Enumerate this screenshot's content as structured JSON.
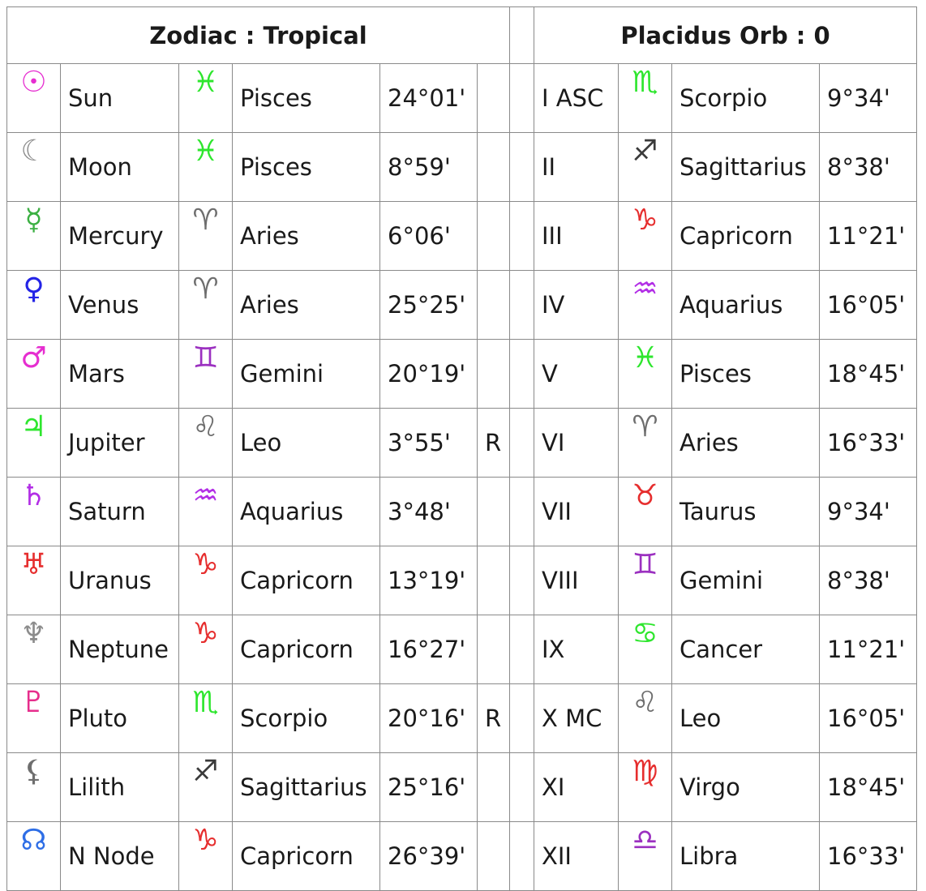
{
  "left_header": "Zodiac : Tropical",
  "right_header": "Placidus Orb : 0",
  "planets": [
    {
      "glyph": "☉",
      "glyph_name": "sun-icon",
      "glyph_color": "#e62ed0",
      "name": "Sun",
      "sign_glyph": "♓",
      "sign_icon": "pisces-icon",
      "sign_color": "#2ee62e",
      "sign": "Pisces",
      "degree": "24°01'",
      "retro": ""
    },
    {
      "glyph": "☾",
      "glyph_name": "moon-icon",
      "glyph_color": "#8c8c8c",
      "name": "Moon",
      "sign_glyph": "♓",
      "sign_icon": "pisces-icon",
      "sign_color": "#2ee62e",
      "sign": "Pisces",
      "degree": "8°59'",
      "retro": ""
    },
    {
      "glyph": "☿",
      "glyph_name": "mercury-icon",
      "glyph_color": "#3cb043",
      "name": "Mercury",
      "sign_glyph": "♈",
      "sign_icon": "aries-icon",
      "sign_color": "#6e6e6e",
      "sign": "Aries",
      "degree": "6°06'",
      "retro": ""
    },
    {
      "glyph": "♀",
      "glyph_name": "venus-icon",
      "glyph_color": "#2424e6",
      "name": "Venus",
      "sign_glyph": "♈",
      "sign_icon": "aries-icon",
      "sign_color": "#6e6e6e",
      "sign": "Aries",
      "degree": "25°25'",
      "retro": ""
    },
    {
      "glyph": "♂",
      "glyph_name": "mars-icon",
      "glyph_color": "#e62ed0",
      "name": "Mars",
      "sign_glyph": "♊",
      "sign_icon": "gemini-icon",
      "sign_color": "#9b30c0",
      "sign": "Gemini",
      "degree": "20°19'",
      "retro": ""
    },
    {
      "glyph": "♃",
      "glyph_name": "jupiter-icon",
      "glyph_color": "#2ee62e",
      "name": "Jupiter",
      "sign_glyph": "♌",
      "sign_icon": "leo-icon",
      "sign_color": "#6e6e6e",
      "sign": "Leo",
      "degree": "3°55'",
      "retro": "R"
    },
    {
      "glyph": "♄",
      "glyph_name": "saturn-icon",
      "glyph_color": "#b22ee6",
      "name": "Saturn",
      "sign_glyph": "♒",
      "sign_icon": "aquarius-icon",
      "sign_color": "#b22ee6",
      "sign": "Aquarius",
      "degree": "3°48'",
      "retro": ""
    },
    {
      "glyph": "♅",
      "glyph_name": "uranus-icon",
      "glyph_color": "#e62e2e",
      "name": "Uranus",
      "sign_glyph": "♑",
      "sign_icon": "capricorn-icon",
      "sign_color": "#e62e2e",
      "sign": "Capricorn",
      "degree": "13°19'",
      "retro": ""
    },
    {
      "glyph": "♆",
      "glyph_name": "neptune-icon",
      "glyph_color": "#8c8c8c",
      "name": "Neptune",
      "sign_glyph": "♑",
      "sign_icon": "capricorn-icon",
      "sign_color": "#e62e2e",
      "sign": "Capricorn",
      "degree": "16°27'",
      "retro": ""
    },
    {
      "glyph": "♇",
      "glyph_name": "pluto-icon",
      "glyph_color": "#e62e8c",
      "name": "Pluto",
      "sign_glyph": "♏",
      "sign_icon": "scorpio-icon",
      "sign_color": "#2ee62e",
      "sign": "Scorpio",
      "degree": "20°16'",
      "retro": "R"
    },
    {
      "glyph": "⚸",
      "glyph_name": "lilith-icon",
      "glyph_color": "#6e6e6e",
      "name": "Lilith",
      "sign_glyph": "♐",
      "sign_icon": "sagittarius-icon",
      "sign_color": "#3a3a3a",
      "sign": "Sagittarius",
      "degree": "25°16'",
      "retro": ""
    },
    {
      "glyph": "☊",
      "glyph_name": "north-node-icon",
      "glyph_color": "#2e6ee6",
      "name": "N Node",
      "sign_glyph": "♑",
      "sign_icon": "capricorn-icon",
      "sign_color": "#e62e2e",
      "sign": "Capricorn",
      "degree": "26°39'",
      "retro": ""
    }
  ],
  "houses": [
    {
      "house": "I ASC",
      "sign_glyph": "♏",
      "sign_icon": "scorpio-icon",
      "sign_color": "#2ee62e",
      "sign": "Scorpio",
      "degree": "9°34'"
    },
    {
      "house": "II",
      "sign_glyph": "♐",
      "sign_icon": "sagittarius-icon",
      "sign_color": "#3a3a3a",
      "sign": "Sagittarius",
      "degree": "8°38'"
    },
    {
      "house": "III",
      "sign_glyph": "♑",
      "sign_icon": "capricorn-icon",
      "sign_color": "#e62e2e",
      "sign": "Capricorn",
      "degree": "11°21'"
    },
    {
      "house": "IV",
      "sign_glyph": "♒",
      "sign_icon": "aquarius-icon",
      "sign_color": "#b22ee6",
      "sign": "Aquarius",
      "degree": "16°05'"
    },
    {
      "house": "V",
      "sign_glyph": "♓",
      "sign_icon": "pisces-icon",
      "sign_color": "#2ee62e",
      "sign": "Pisces",
      "degree": "18°45'"
    },
    {
      "house": "VI",
      "sign_glyph": "♈",
      "sign_icon": "aries-icon",
      "sign_color": "#6e6e6e",
      "sign": "Aries",
      "degree": "16°33'"
    },
    {
      "house": "VII",
      "sign_glyph": "♉",
      "sign_icon": "taurus-icon",
      "sign_color": "#e62e2e",
      "sign": "Taurus",
      "degree": "9°34'"
    },
    {
      "house": "VIII",
      "sign_glyph": "♊",
      "sign_icon": "gemini-icon",
      "sign_color": "#9b30c0",
      "sign": "Gemini",
      "degree": "8°38'"
    },
    {
      "house": "IX",
      "sign_glyph": "♋",
      "sign_icon": "cancer-icon",
      "sign_color": "#2ee62e",
      "sign": "Cancer",
      "degree": "11°21'"
    },
    {
      "house": "X MC",
      "sign_glyph": "♌",
      "sign_icon": "leo-icon",
      "sign_color": "#6e6e6e",
      "sign": "Leo",
      "degree": "16°05'"
    },
    {
      "house": "XI",
      "sign_glyph": "♍",
      "sign_icon": "virgo-icon",
      "sign_color": "#e62e2e",
      "sign": "Virgo",
      "degree": "18°45'"
    },
    {
      "house": "XII",
      "sign_glyph": "♎",
      "sign_icon": "libra-icon",
      "sign_color": "#9b30c0",
      "sign": "Libra",
      "degree": "16°33'"
    }
  ]
}
